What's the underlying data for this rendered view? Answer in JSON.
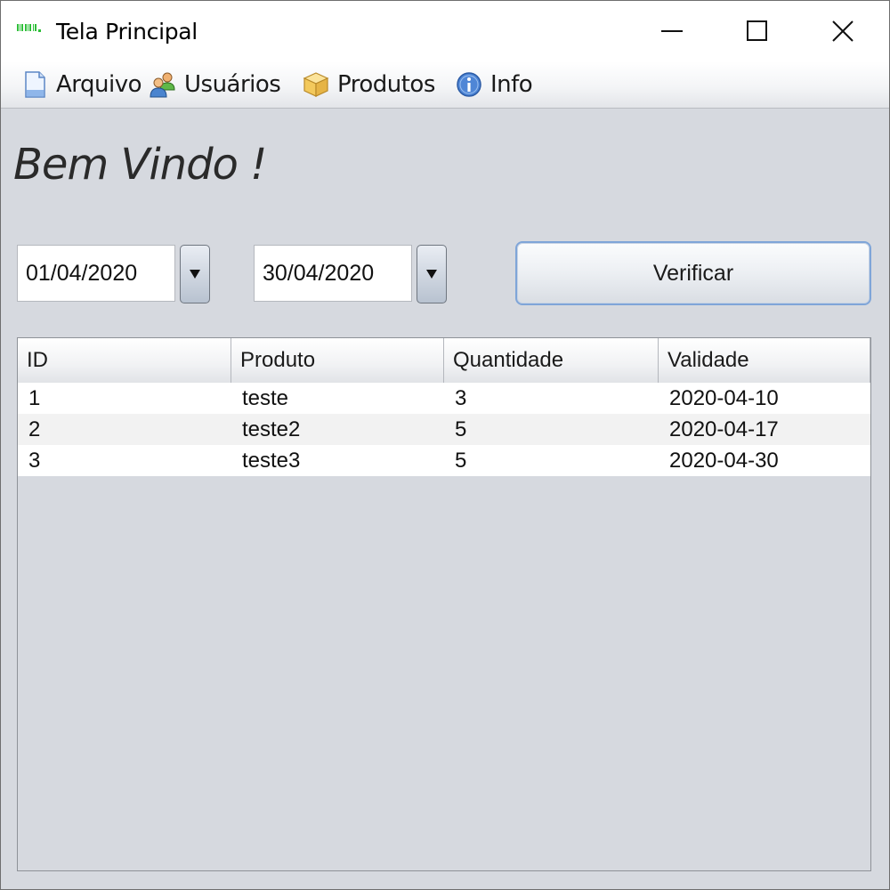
{
  "window": {
    "title": "Tela Principal",
    "controls": {
      "minimize_icon": "minimize-icon",
      "maximize_icon": "maximize-icon",
      "close_icon": "close-icon"
    }
  },
  "menubar": {
    "items": [
      {
        "label": "Arquivo",
        "icon": "document-icon"
      },
      {
        "label": "Usuários",
        "icon": "users-icon"
      },
      {
        "label": "Produtos",
        "icon": "box-icon"
      },
      {
        "label": "Info",
        "icon": "info-icon"
      }
    ]
  },
  "main": {
    "welcome": "Bem Vindo !",
    "date_start": "01/04/2020",
    "date_end": "30/04/2020",
    "verify_label": "Verificar"
  },
  "table": {
    "columns": [
      "ID",
      "Produto",
      "Quantidade",
      "Validade"
    ],
    "rows": [
      [
        "1",
        "teste",
        "3",
        "2020-04-10"
      ],
      [
        "2",
        "teste2",
        "5",
        "2020-04-17"
      ],
      [
        "3",
        "teste3",
        "5",
        "2020-04-30"
      ]
    ]
  },
  "colors": {
    "window_bg": "#d6d9df",
    "button_focus_border": "#7fa5d8",
    "app_icon_green": "#2fbf3a"
  }
}
